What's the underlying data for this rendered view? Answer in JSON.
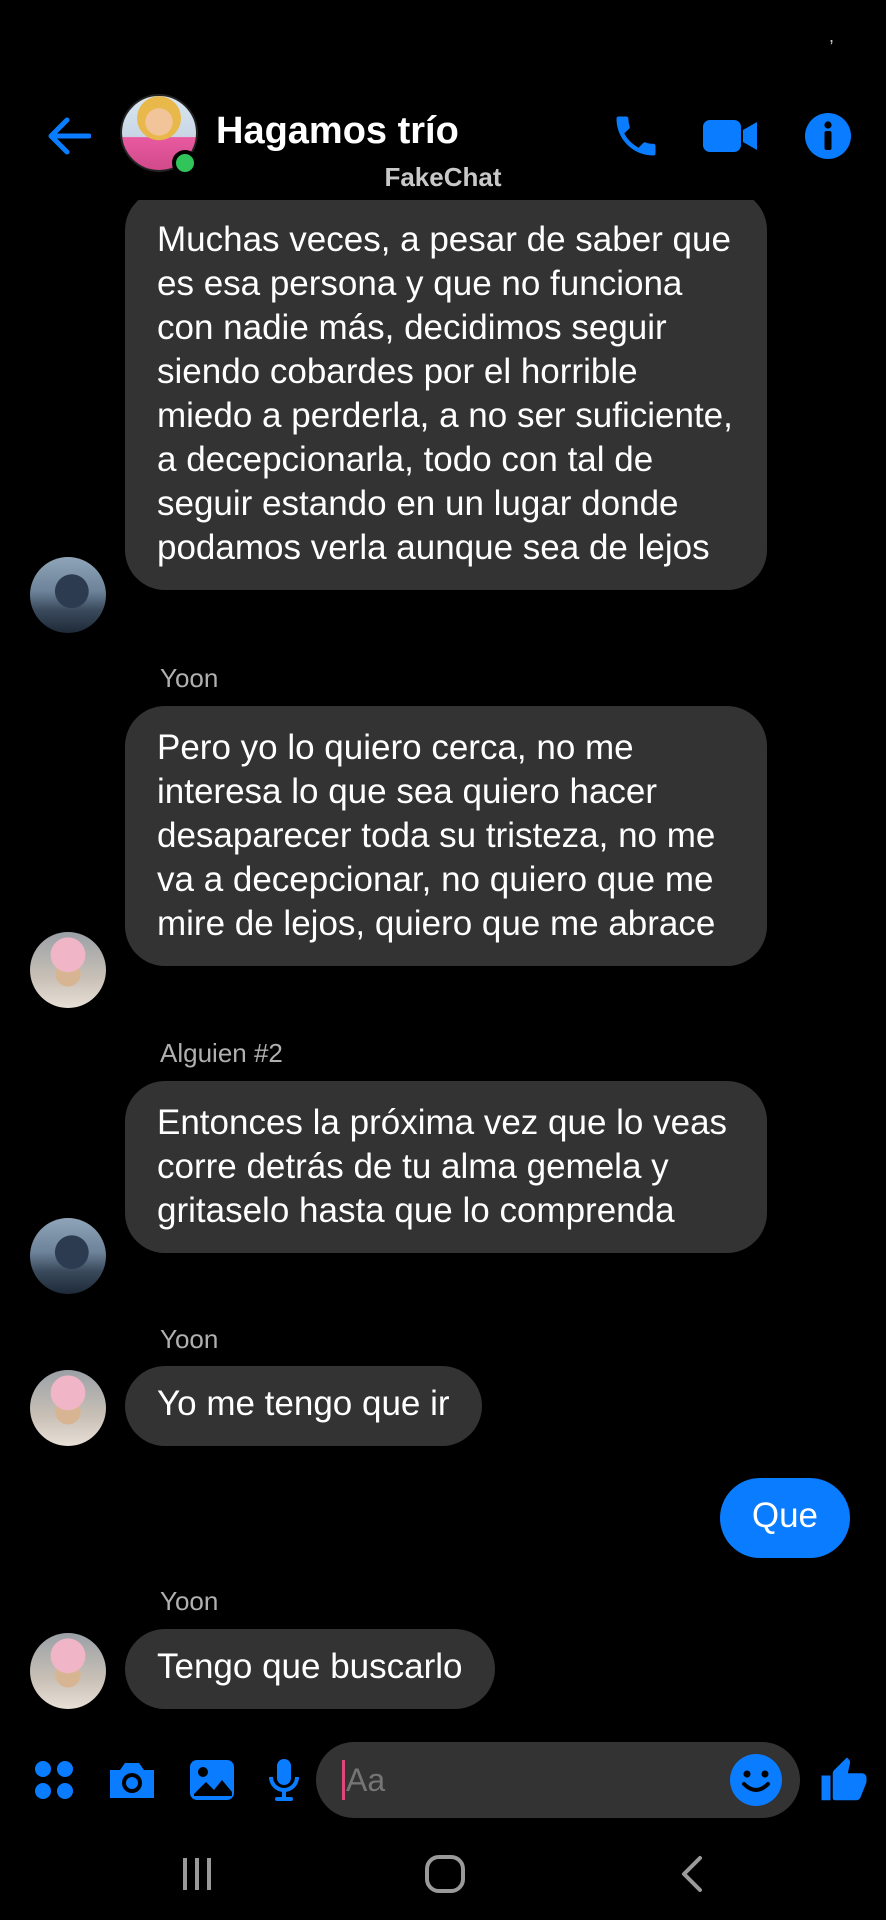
{
  "status_bar": {
    "mark": ","
  },
  "header": {
    "title": "Hagamos trío",
    "watermark": "FakeChat",
    "icons": {
      "back": "back-arrow-icon",
      "phone": "phone-icon",
      "video": "video-camera-icon",
      "info": "info-icon"
    }
  },
  "colors": {
    "accent": "#0a7cff",
    "bubble_incoming": "#333333",
    "background": "#000000",
    "online": "#31c45a",
    "caret": "#e0457b"
  },
  "messages": [
    {
      "sender": "",
      "text": "Muchas veces, a pesar de saber que es esa persona y que no funciona con nadie más, decidimos seguir siendo cobardes por el horrible miedo a perderla, a no ser suficiente, a decepcionarla, todo con tal de seguir estando en un lugar donde podamos verla aunque sea de lejos",
      "outgoing": false
    },
    {
      "sender": "Yoon",
      "text": "Pero yo lo quiero cerca, no me interesa lo que sea quiero hacer desaparecer toda su tristeza, no me va a decepcionar, no quiero que me mire de lejos, quiero que me abrace",
      "outgoing": false
    },
    {
      "sender": "Alguien #2",
      "text": "Entonces la próxima vez que lo veas corre detrás de tu alma gemela y gritaselo hasta que lo comprenda",
      "outgoing": false
    },
    {
      "sender": "Yoon",
      "text": "Yo me tengo que ir",
      "outgoing": false
    },
    {
      "sender": "",
      "text": "Que",
      "outgoing": true
    },
    {
      "sender": "Yoon",
      "text": "Tengo que buscarlo",
      "outgoing": false
    }
  ],
  "composer": {
    "placeholder": "Aa",
    "icons": [
      "apps-grid-icon",
      "camera-icon",
      "gallery-icon",
      "microphone-icon",
      "emoji-icon",
      "thumbs-up-icon"
    ]
  },
  "navbar": {
    "icons": [
      "recent-apps-icon",
      "home-icon",
      "back-icon"
    ]
  }
}
